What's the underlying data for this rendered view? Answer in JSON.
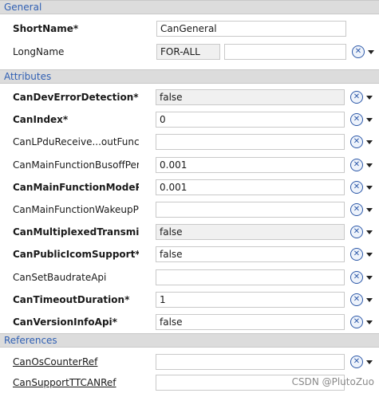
{
  "sections": {
    "general": "General",
    "attributes": "Attributes",
    "references": "References"
  },
  "general": {
    "short_name": {
      "label": "ShortName*",
      "value": "CanGeneral"
    },
    "long_name": {
      "label": "LongName",
      "lang": "FOR-ALL",
      "value": ""
    }
  },
  "attributes": [
    {
      "label": "CanDevErrorDetection*",
      "value": "false"
    },
    {
      "label": "CanIndex*",
      "value": "0"
    },
    {
      "label": "CanLPduReceive...outFunct",
      "value": ""
    },
    {
      "label": "CanMainFunctionBusoffPer",
      "value": "0.001"
    },
    {
      "label": "CanMainFunctionModePe",
      "value": "0.001"
    },
    {
      "label": "CanMainFunctionWakeupP",
      "value": ""
    },
    {
      "label": "CanMultiplexedTransmissi",
      "value": "false"
    },
    {
      "label": "CanPublicIcomSupport*",
      "value": "false"
    },
    {
      "label": "CanSetBaudrateApi",
      "value": ""
    },
    {
      "label": "CanTimeoutDuration*",
      "value": "1"
    },
    {
      "label": "CanVersionInfoApi*",
      "value": "false"
    }
  ],
  "references": [
    {
      "label": "CanOsCounterRef",
      "value": ""
    },
    {
      "label": "CanSupportTTCANRef",
      "value": ""
    }
  ],
  "watermark": "CSDN @PlutoZuo",
  "icons": {
    "action": "reset-icon",
    "dropdown": "chevron-down-icon"
  },
  "colors": {
    "section_header_bg": "#dcdcdc",
    "section_title": "#2f5fb3",
    "icon_stroke": "#2c58a8"
  }
}
